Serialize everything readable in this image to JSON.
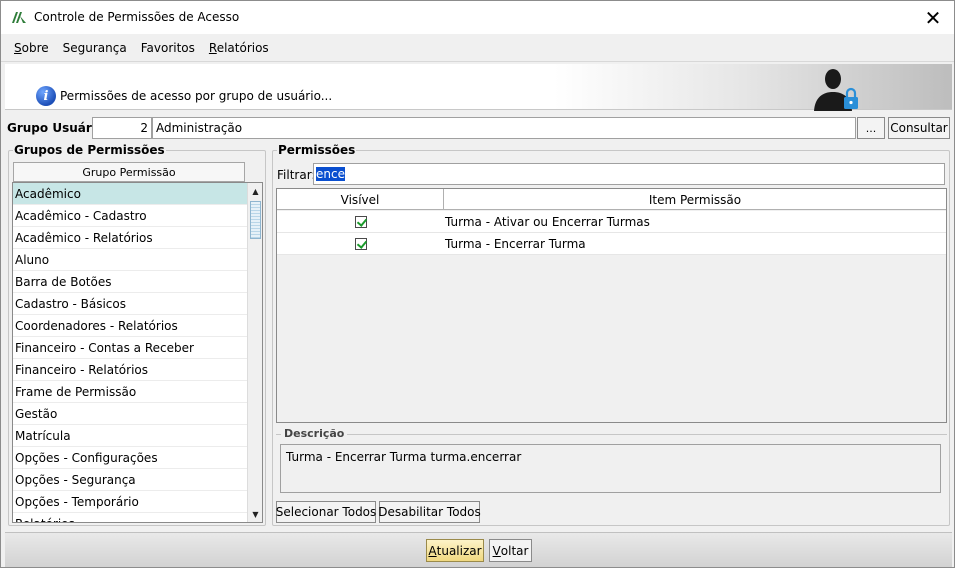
{
  "window": {
    "title": "Controle de Permissões de Acesso",
    "close_glyph": "✕"
  },
  "menu": [
    {
      "first": "S",
      "rest": "obre"
    },
    {
      "first": "",
      "rest": "Segurança"
    },
    {
      "first": "",
      "rest": "Favoritos"
    },
    {
      "first": "R",
      "rest": "elatórios"
    }
  ],
  "banner": {
    "info_glyph": "i",
    "text": "Permissões de acesso por grupo de usuário..."
  },
  "group": {
    "label": "Grupo Usuário:",
    "id": "2",
    "name": "Administração",
    "ellipsis_label": "...",
    "consultar_label": "Consultar"
  },
  "left_panel": {
    "legend": "Grupos de Permissões",
    "column_header": "Grupo Permissão",
    "selected_index": 0,
    "items": [
      "Acadêmico",
      "Acadêmico - Cadastro",
      "Acadêmico - Relatórios",
      "Aluno",
      "Barra de Botões",
      "Cadastro - Básicos",
      "Coordenadores - Relatórios",
      "Financeiro - Contas a Receber",
      "Financeiro - Relatórios",
      "Frame de Permissão",
      "Gestão",
      "Matrícula",
      "Opções - Configurações",
      "Opções - Segurança",
      "Opções - Temporário",
      "Relatórios"
    ],
    "scroll_up_glyph": "▲",
    "scroll_down_glyph": "▼"
  },
  "right_panel": {
    "legend": "Permissões",
    "filter_label": "Filtrar:",
    "filter_value": "ence",
    "columns": [
      "Visível",
      "Item Permissão"
    ],
    "rows": [
      {
        "visible": true,
        "item": "Turma - Ativar ou Encerrar Turmas"
      },
      {
        "visible": true,
        "item": "Turma - Encerrar Turma"
      }
    ],
    "description_label": "Descrição",
    "description_text": "Turma - Encerrar Turma turma.encerrar",
    "select_all_label": "Selecionar Todos",
    "disable_all_label": "Desabilitar Todos"
  },
  "footer": {
    "atualizar_first": "A",
    "atualizar_rest": "tualizar",
    "voltar_first": "V",
    "voltar_rest": "oltar"
  },
  "colors": {
    "selected_row": "#c7e6e6",
    "filter_selection": "#0a4fd0",
    "check_color": "#1a9a2a",
    "info_icon": "#1d4fb8",
    "lock_icon": "#2a8fd8"
  }
}
